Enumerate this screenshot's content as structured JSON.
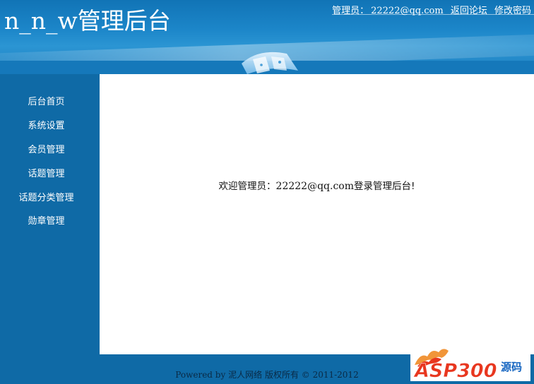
{
  "header": {
    "site_title": "n_n_w管理后台",
    "admin_label": "管理员：",
    "admin_email": "22222@qq.com",
    "back_forum": "返回论坛",
    "change_password": "修改密码"
  },
  "sidebar": {
    "items": [
      {
        "label": "后台首页"
      },
      {
        "label": "系统设置"
      },
      {
        "label": "会员管理"
      },
      {
        "label": "话题管理"
      },
      {
        "label": "话题分类管理"
      },
      {
        "label": "勋章管理"
      }
    ]
  },
  "main": {
    "welcome_prefix": "欢迎管理员：",
    "welcome_email": "22222@qq.com",
    "welcome_suffix": "登录管理后台!"
  },
  "footer": {
    "powered_by": "Powered by",
    "company": "泥人网络",
    "copyright": "版权所有 © 2011-2012"
  },
  "watermark": {
    "brand": "ASP300",
    "suffix": "源码"
  },
  "colors": {
    "page_bg": "#0f6aa6",
    "header_bg": "#1c86c9",
    "content_bg": "#ffffff",
    "watermark_red": "#e8371f",
    "watermark_blue": "#1565c0"
  }
}
